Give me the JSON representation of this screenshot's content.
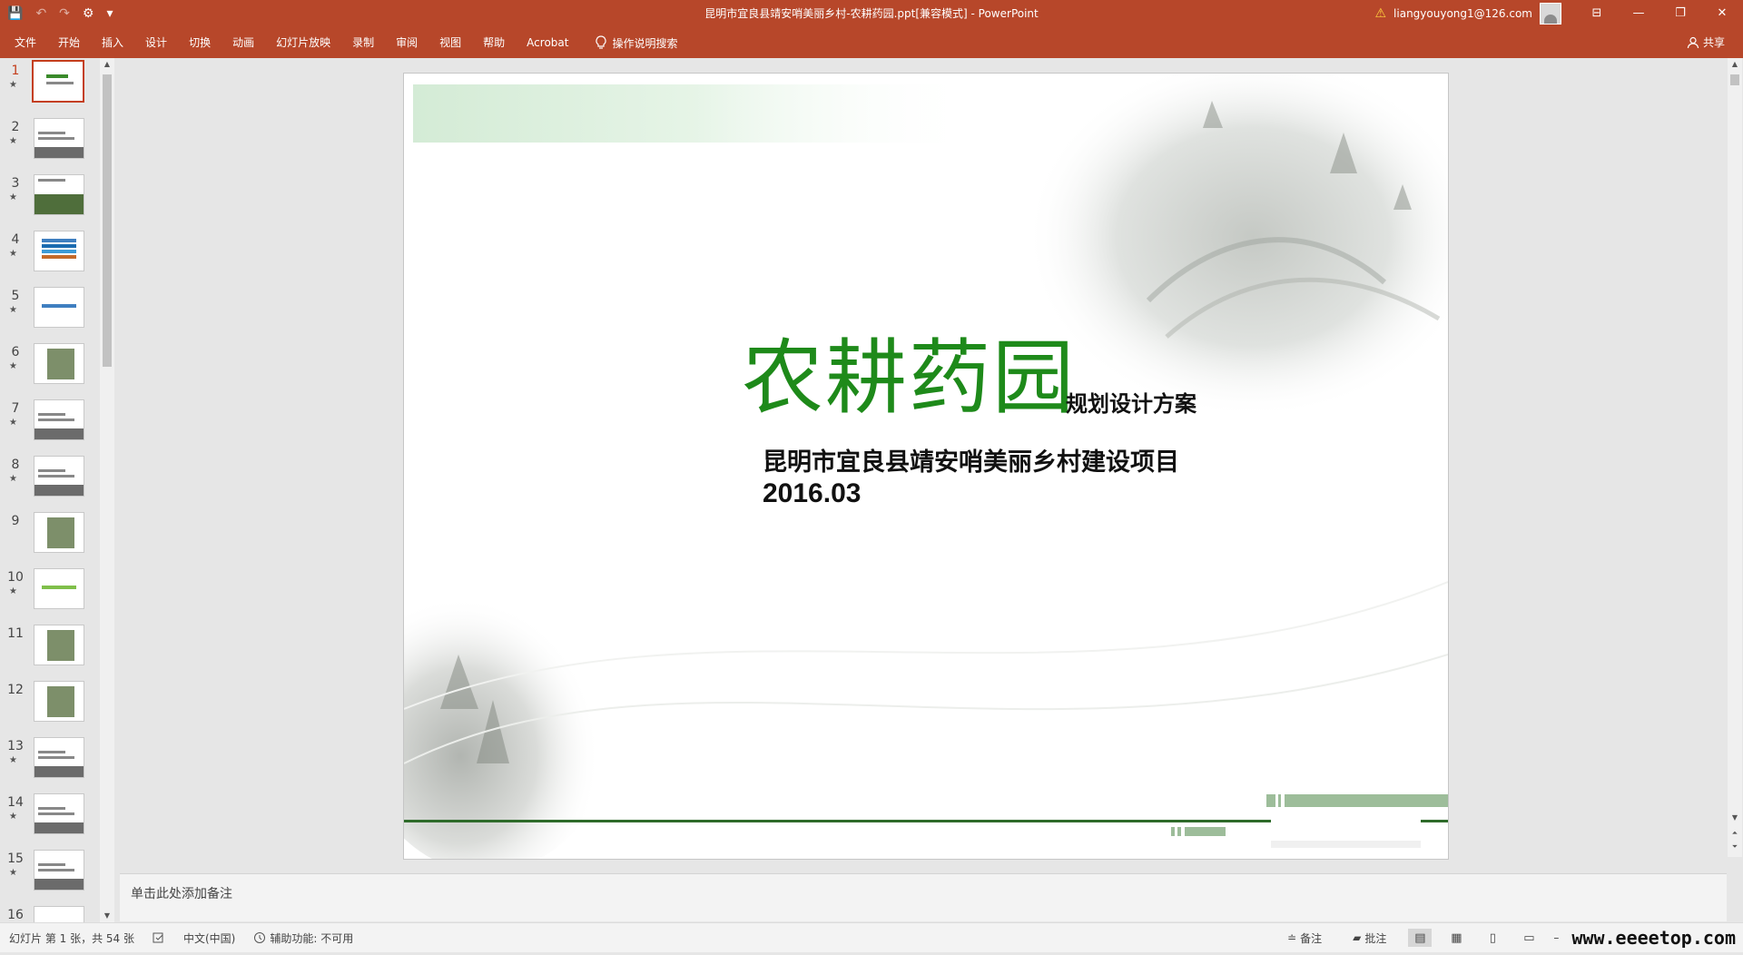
{
  "window": {
    "title": "昆明市宜良县靖安哨美丽乡村-农耕药园.ppt[兼容模式]  -  PowerPoint",
    "account": "liangyouyong1@126.com",
    "minimize": "—",
    "restore": "❐",
    "close": "✕",
    "ribbon_display": "⊟"
  },
  "qat": {
    "save": "💾",
    "undo": "↶",
    "redo": "↷",
    "custom": "⚙",
    "more": "▾"
  },
  "menu": {
    "tabs": [
      "文件",
      "开始",
      "插入",
      "设计",
      "切换",
      "动画",
      "幻灯片放映",
      "录制",
      "审阅",
      "视图",
      "帮助",
      "Acrobat"
    ],
    "tell_me": "操作说明搜索",
    "share": "共享"
  },
  "thumbnails": [
    {
      "num": "1",
      "star": "★",
      "style": "title"
    },
    {
      "num": "2",
      "star": "★",
      "style": "photo"
    },
    {
      "num": "3",
      "star": "★",
      "style": "landscape"
    },
    {
      "num": "4",
      "star": "★",
      "style": "bars"
    },
    {
      "num": "5",
      "star": "★",
      "style": "blue"
    },
    {
      "num": "6",
      "star": "★",
      "style": "map"
    },
    {
      "num": "7",
      "star": "★",
      "style": "photo"
    },
    {
      "num": "8",
      "star": "★",
      "style": "photo"
    },
    {
      "num": "9",
      "star": "",
      "style": "map"
    },
    {
      "num": "10",
      "star": "★",
      "style": "green"
    },
    {
      "num": "11",
      "star": "",
      "style": "map"
    },
    {
      "num": "12",
      "star": "",
      "style": "map"
    },
    {
      "num": "13",
      "star": "★",
      "style": "photo"
    },
    {
      "num": "14",
      "star": "★",
      "style": "photo"
    },
    {
      "num": "15",
      "star": "★",
      "style": "photo"
    },
    {
      "num": "16",
      "star": "",
      "style": "blank"
    }
  ],
  "slide": {
    "title": "农耕药园",
    "subtitle": "规划设计方案",
    "project": "昆明市宜良县靖安哨美丽乡村建设项目",
    "date": "2016.03",
    "colors": {
      "title_green": "#1e8a1a",
      "line_green": "#2e6b2a",
      "block_green": "#9dbd9a"
    }
  },
  "notes": {
    "placeholder": "单击此处添加备注"
  },
  "status": {
    "slide_info": "幻灯片 第 1 张，共 54 张",
    "language": "中文(中国)",
    "accessibility": "辅助功能: 不可用",
    "notes_btn": "备注",
    "comments_btn": "批注",
    "watermark": "www.eeeetop.com"
  }
}
